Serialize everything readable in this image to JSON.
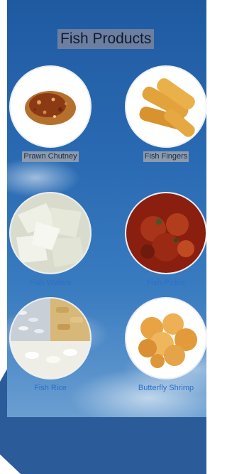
{
  "page": {
    "title": "Fish Products"
  },
  "products": [
    {
      "name": "Prawn Chutney"
    },
    {
      "name": "Fish Fingers"
    },
    {
      "name": "Fish Wafers"
    },
    {
      "name": "Fish Pickle"
    },
    {
      "name": "Fish Rice"
    },
    {
      "name": "Butterfly Shrimp"
    }
  ],
  "colors": {
    "accent_blue": "#2b5b98",
    "label_blue": "#2f6fc6",
    "sky_top": "#1f5aa1"
  }
}
